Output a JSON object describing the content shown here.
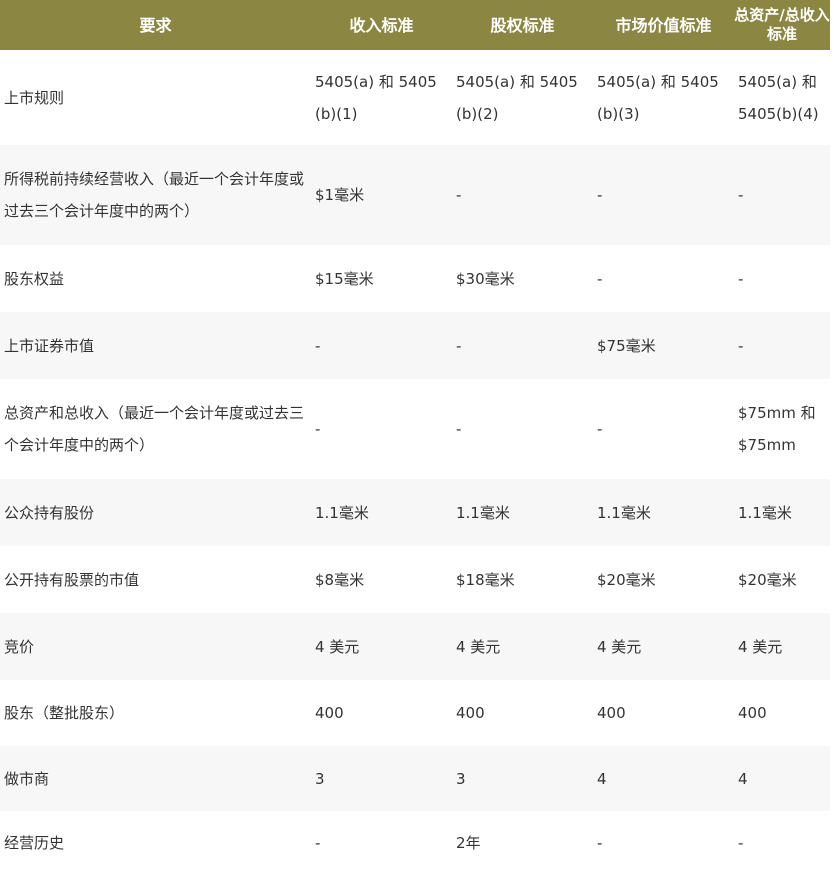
{
  "headers": [
    "要求",
    "收入标准",
    "股权标准",
    "市场价值标准",
    "总资产/总收入标准"
  ],
  "rows": [
    {
      "label": "上市规则",
      "cells": [
        "5405(a) 和 5405(b)(1)",
        "5405(a) 和 5405(b)(2)",
        "5405(a) 和 5405(b)(3)",
        "5405(a) 和 5405(b)(4)"
      ]
    },
    {
      "label": "所得税前持续经营收入（最近一个会计年度或过去三个会计年度中的两个）",
      "cells": [
        "$1毫米",
        "-",
        "-",
        "-"
      ]
    },
    {
      "label": "股东权益",
      "cells": [
        "$15毫米",
        "$30毫米",
        "-",
        "-"
      ]
    },
    {
      "label": "上市证券市值",
      "cells": [
        "-",
        "-",
        "$75毫米",
        "-"
      ]
    },
    {
      "label": "总资产和总收入（最近一个会计年度或过去三个会计年度中的两个）",
      "cells": [
        "-",
        "-",
        "-",
        "$75mm 和 $75mm"
      ]
    },
    {
      "label": "公众持有股份",
      "cells": [
        "1.1毫米",
        "1.1毫米",
        "1.1毫米",
        "1.1毫米"
      ]
    },
    {
      "label": "公开持有股票的市值",
      "cells": [
        "$8毫米",
        "$18毫米",
        "$20毫米",
        "$20毫米"
      ]
    },
    {
      "label": "竞价",
      "cells": [
        "4 美元",
        "4 美元",
        "4 美元",
        "4 美元"
      ]
    },
    {
      "label": "股东（整批股东）",
      "cells": [
        "400",
        "400",
        "400",
        "400"
      ]
    },
    {
      "label": "做市商",
      "cells": [
        "3",
        "3",
        "4",
        "4"
      ]
    },
    {
      "label": "经营历史",
      "cells": [
        "-",
        "2年",
        "-",
        "-"
      ]
    }
  ]
}
